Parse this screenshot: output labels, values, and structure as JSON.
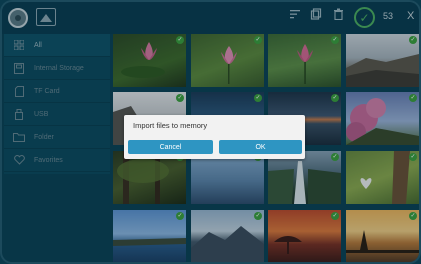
{
  "topbar": {
    "selected_count": "53",
    "close_label": "X",
    "icons": [
      "app-logo-icon",
      "image-icon",
      "sort-icon",
      "copy-icon",
      "trash-icon",
      "check-all-icon"
    ]
  },
  "sidebar": {
    "items": [
      {
        "label": "All",
        "icon": "grid-icon"
      },
      {
        "label": "Internal Storage",
        "icon": "storage-icon"
      },
      {
        "label": "TF Card",
        "icon": "sd-card-icon"
      },
      {
        "label": "USB",
        "icon": "usb-icon"
      },
      {
        "label": "Folder",
        "icon": "folder-icon"
      },
      {
        "label": "Favorites",
        "icon": "heart-icon"
      }
    ]
  },
  "grid": {
    "thumbnails": [
      {
        "subject": "lotus",
        "checked": true
      },
      {
        "subject": "lotus",
        "checked": true
      },
      {
        "subject": "lotus",
        "checked": true
      },
      {
        "subject": "coast",
        "checked": true
      },
      {
        "subject": "rock",
        "checked": true
      },
      {
        "subject": "sea",
        "checked": true
      },
      {
        "subject": "dusk sea",
        "checked": true
      },
      {
        "subject": "blossom",
        "checked": true
      },
      {
        "subject": "forest",
        "checked": true
      },
      {
        "subject": "sea",
        "checked": true
      },
      {
        "subject": "waterfall",
        "checked": true
      },
      {
        "subject": "tree",
        "checked": true
      },
      {
        "subject": "lake",
        "checked": true
      },
      {
        "subject": "mountains",
        "checked": true
      },
      {
        "subject": "sunset",
        "checked": true
      },
      {
        "subject": "tree",
        "checked": true
      }
    ]
  },
  "dialog": {
    "title": "Import files to memory",
    "cancel_label": "Cancel",
    "ok_label": "OK"
  }
}
